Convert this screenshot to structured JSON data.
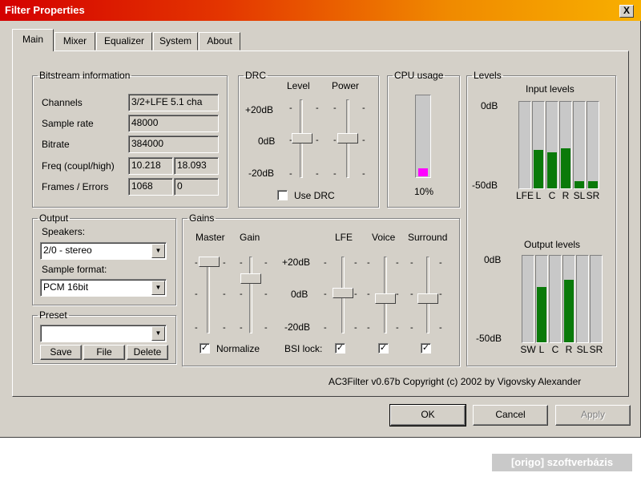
{
  "window": {
    "title": "Filter Properties",
    "close_glyph": "X"
  },
  "tabs": [
    {
      "label": "Main",
      "active": true
    },
    {
      "label": "Mixer"
    },
    {
      "label": "Equalizer"
    },
    {
      "label": "System"
    },
    {
      "label": "About"
    }
  ],
  "bitstream": {
    "legend": "Bitstream information",
    "channels_label": "Channels",
    "channels_value": "3/2+LFE 5.1 cha",
    "sample_rate_label": "Sample rate",
    "sample_rate_value": "48000",
    "bitrate_label": "Bitrate",
    "bitrate_value": "384000",
    "freq_label": "Freq (coupl/high)",
    "freq_coupl": "10.218",
    "freq_high": "18.093",
    "frames_label": "Frames / Errors",
    "frames": "1068",
    "errors": "0"
  },
  "drc": {
    "legend": "DRC",
    "level_label": "Level",
    "power_label": "Power",
    "plus20": "+20dB",
    "zero": "0dB",
    "minus20": "-20dB",
    "use_drc_label": "Use DRC",
    "use_drc_checked": false
  },
  "cpu": {
    "legend": "CPU usage",
    "value_text": "10%",
    "fraction": 0.1,
    "color": "#ff00ff"
  },
  "levels": {
    "legend": "Levels",
    "input_title": "Input levels",
    "output_title": "Output levels",
    "top_label": "0dB",
    "bottom_label": "-50dB",
    "bar_color": "#0a7a0a",
    "input_channels": [
      {
        "label": "LFE",
        "fraction": 0.0
      },
      {
        "label": "L",
        "fraction": 0.44
      },
      {
        "label": "C",
        "fraction": 0.42
      },
      {
        "label": "R",
        "fraction": 0.46
      },
      {
        "label": "SL",
        "fraction": 0.08
      },
      {
        "label": "SR",
        "fraction": 0.08
      }
    ],
    "output_channels": [
      {
        "label": "SW",
        "fraction": 0.0
      },
      {
        "label": "L",
        "fraction": 0.64
      },
      {
        "label": "C",
        "fraction": 0.0
      },
      {
        "label": "R",
        "fraction": 0.72
      },
      {
        "label": "SL",
        "fraction": 0.0
      },
      {
        "label": "SR",
        "fraction": 0.0
      }
    ]
  },
  "output": {
    "legend": "Output",
    "speakers_label": "Speakers:",
    "speakers_value": "2/0 - stereo",
    "format_label": "Sample format:",
    "format_value": "PCM 16bit"
  },
  "preset": {
    "legend": "Preset",
    "value": "",
    "save": "Save",
    "file": "File",
    "delete": "Delete"
  },
  "gains": {
    "legend": "Gains",
    "master_label": "Master",
    "gain_label": "Gain",
    "lfe_label": "LFE",
    "voice_label": "Voice",
    "surround_label": "Surround",
    "plus20": "+20dB",
    "zero": "0dB",
    "minus20": "-20dB",
    "normalize_label": "Normalize",
    "normalize_checked": true,
    "bsi_label": "BSI lock:",
    "bsi_lfe_checked": true,
    "bsi_voice_checked": true,
    "bsi_surround_checked": true
  },
  "copyright": "AC3Filter v0.67b Copyright (c) 2002 by Vigovsky Alexander",
  "buttons": {
    "ok": "OK",
    "cancel": "Cancel",
    "apply": "Apply"
  },
  "watermark": "[origo] szoftverbázis"
}
